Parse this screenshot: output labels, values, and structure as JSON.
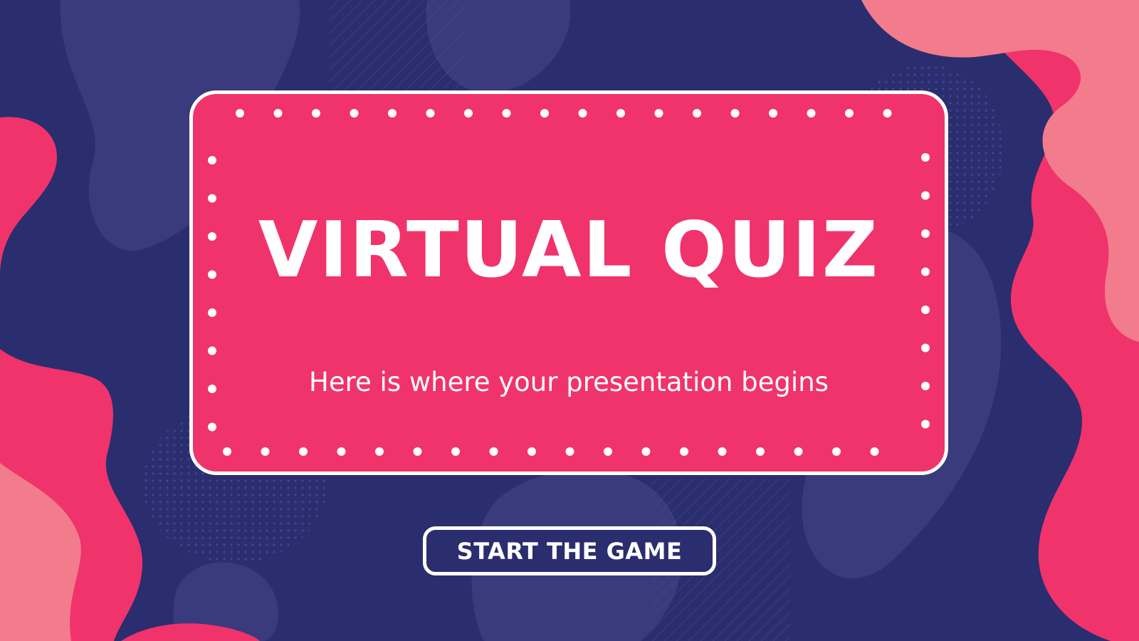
{
  "slide": {
    "title": "VIRTUAL QUIZ",
    "subtitle": "Here is where your presentation begins",
    "button_label": "START THE GAME"
  },
  "colors": {
    "background_navy": "#2a2d6e",
    "blob_navy_light": "#3a3b7c",
    "accent_pink": "#f0336b",
    "accent_pink_light": "#f27c8c",
    "white": "#ffffff"
  }
}
